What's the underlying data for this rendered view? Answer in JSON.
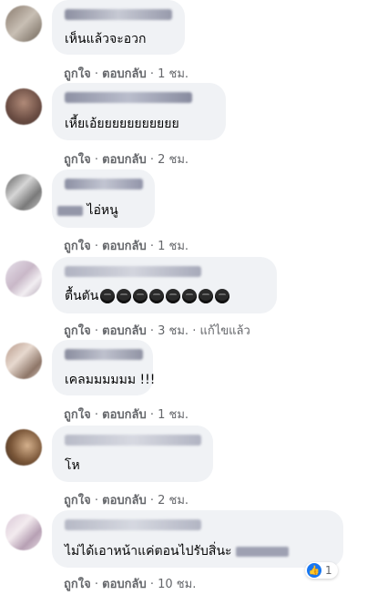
{
  "colors": {
    "bubble": "#f0f2f5",
    "meta": "#65676b",
    "like": "#1877f2"
  },
  "comments": [
    {
      "text": "เห็นแล้วจะอวก",
      "like_label": "ถูกใจ",
      "reply_label": "ตอบกลับ",
      "time": "1 ชม."
    },
    {
      "text": "เหี้ยเอ้ยยยยยยยยยยย",
      "like_label": "ถูกใจ",
      "reply_label": "ตอบกลับ",
      "time": "2 ชม."
    },
    {
      "text": "ไอ่หนู",
      "like_label": "ถูกใจ",
      "reply_label": "ตอบกลับ",
      "time": "1 ชม."
    },
    {
      "text": "ตื้นตัน",
      "emoji_icon": "sad-face-icon",
      "emoji_count": 8,
      "like_label": "ถูกใจ",
      "reply_label": "ตอบกลับ",
      "time": "3 ชม.",
      "edited_label": "แก้ไขแล้ว"
    },
    {
      "text": "เคลมมมมมม !!!",
      "like_label": "ถูกใจ",
      "reply_label": "ตอบกลับ",
      "time": "1 ชม."
    },
    {
      "text": "โห",
      "like_label": "ถูกใจ",
      "reply_label": "ตอบกลับ",
      "time": "2 ชม."
    },
    {
      "text": "ไม่ได้เอาหน้าแค่ตอนไปรับสิ่นะ",
      "like_label": "ถูกใจ",
      "reply_label": "ตอบกลับ",
      "time": "10 ชม.",
      "reaction_icon": "like-icon",
      "reaction_count": "1"
    }
  ]
}
